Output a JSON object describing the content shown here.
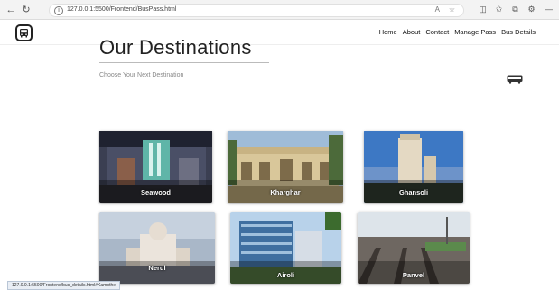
{
  "browser": {
    "url": "127.0.0.1:5500/Frontend/BusPass.html",
    "status_url": "127.0.0.1:5500/Frontend/bus_details.html#Kamothe",
    "icons": [
      "back-icon",
      "refresh-icon",
      "info-icon",
      "read-aloud-icon",
      "favorite-icon",
      "split-screen-icon",
      "favorites-bar-icon",
      "collections-icon",
      "extensions-icon",
      "minimize-icon"
    ]
  },
  "header": {
    "logo_icon": "bus-icon",
    "nav": [
      "Home",
      "About",
      "Contact",
      "Manage Pass",
      "Bus Details"
    ]
  },
  "section": {
    "title": "Our Destinations",
    "subtitle": "Choose Your Next Destination"
  },
  "destinations": [
    {
      "name": "Seawood"
    },
    {
      "name": "Kharghar"
    },
    {
      "name": "Ghansoli"
    },
    {
      "name": "Nerul"
    },
    {
      "name": "Airoli"
    },
    {
      "name": "Panvel"
    }
  ]
}
